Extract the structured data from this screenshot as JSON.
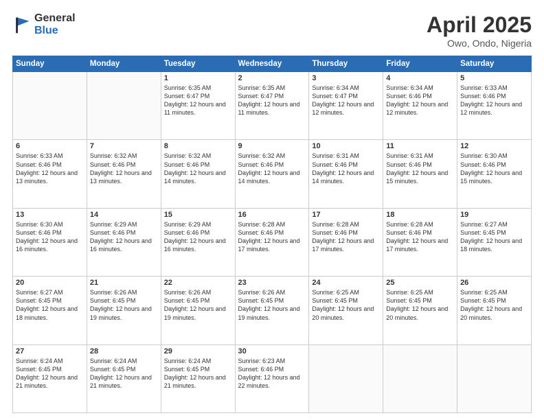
{
  "logo": {
    "general": "General",
    "blue": "Blue"
  },
  "title": {
    "month": "April 2025",
    "location": "Owo, Ondo, Nigeria"
  },
  "weekdays": [
    "Sunday",
    "Monday",
    "Tuesday",
    "Wednesday",
    "Thursday",
    "Friday",
    "Saturday"
  ],
  "weeks": [
    [
      {
        "day": "",
        "info": ""
      },
      {
        "day": "",
        "info": ""
      },
      {
        "day": "1",
        "info": "Sunrise: 6:35 AM\nSunset: 6:47 PM\nDaylight: 12 hours and 11 minutes."
      },
      {
        "day": "2",
        "info": "Sunrise: 6:35 AM\nSunset: 6:47 PM\nDaylight: 12 hours and 11 minutes."
      },
      {
        "day": "3",
        "info": "Sunrise: 6:34 AM\nSunset: 6:47 PM\nDaylight: 12 hours and 12 minutes."
      },
      {
        "day": "4",
        "info": "Sunrise: 6:34 AM\nSunset: 6:46 PM\nDaylight: 12 hours and 12 minutes."
      },
      {
        "day": "5",
        "info": "Sunrise: 6:33 AM\nSunset: 6:46 PM\nDaylight: 12 hours and 12 minutes."
      }
    ],
    [
      {
        "day": "6",
        "info": "Sunrise: 6:33 AM\nSunset: 6:46 PM\nDaylight: 12 hours and 13 minutes."
      },
      {
        "day": "7",
        "info": "Sunrise: 6:32 AM\nSunset: 6:46 PM\nDaylight: 12 hours and 13 minutes."
      },
      {
        "day": "8",
        "info": "Sunrise: 6:32 AM\nSunset: 6:46 PM\nDaylight: 12 hours and 14 minutes."
      },
      {
        "day": "9",
        "info": "Sunrise: 6:32 AM\nSunset: 6:46 PM\nDaylight: 12 hours and 14 minutes."
      },
      {
        "day": "10",
        "info": "Sunrise: 6:31 AM\nSunset: 6:46 PM\nDaylight: 12 hours and 14 minutes."
      },
      {
        "day": "11",
        "info": "Sunrise: 6:31 AM\nSunset: 6:46 PM\nDaylight: 12 hours and 15 minutes."
      },
      {
        "day": "12",
        "info": "Sunrise: 6:30 AM\nSunset: 6:46 PM\nDaylight: 12 hours and 15 minutes."
      }
    ],
    [
      {
        "day": "13",
        "info": "Sunrise: 6:30 AM\nSunset: 6:46 PM\nDaylight: 12 hours and 16 minutes."
      },
      {
        "day": "14",
        "info": "Sunrise: 6:29 AM\nSunset: 6:46 PM\nDaylight: 12 hours and 16 minutes."
      },
      {
        "day": "15",
        "info": "Sunrise: 6:29 AM\nSunset: 6:46 PM\nDaylight: 12 hours and 16 minutes."
      },
      {
        "day": "16",
        "info": "Sunrise: 6:28 AM\nSunset: 6:46 PM\nDaylight: 12 hours and 17 minutes."
      },
      {
        "day": "17",
        "info": "Sunrise: 6:28 AM\nSunset: 6:46 PM\nDaylight: 12 hours and 17 minutes."
      },
      {
        "day": "18",
        "info": "Sunrise: 6:28 AM\nSunset: 6:46 PM\nDaylight: 12 hours and 17 minutes."
      },
      {
        "day": "19",
        "info": "Sunrise: 6:27 AM\nSunset: 6:45 PM\nDaylight: 12 hours and 18 minutes."
      }
    ],
    [
      {
        "day": "20",
        "info": "Sunrise: 6:27 AM\nSunset: 6:45 PM\nDaylight: 12 hours and 18 minutes."
      },
      {
        "day": "21",
        "info": "Sunrise: 6:26 AM\nSunset: 6:45 PM\nDaylight: 12 hours and 19 minutes."
      },
      {
        "day": "22",
        "info": "Sunrise: 6:26 AM\nSunset: 6:45 PM\nDaylight: 12 hours and 19 minutes."
      },
      {
        "day": "23",
        "info": "Sunrise: 6:26 AM\nSunset: 6:45 PM\nDaylight: 12 hours and 19 minutes."
      },
      {
        "day": "24",
        "info": "Sunrise: 6:25 AM\nSunset: 6:45 PM\nDaylight: 12 hours and 20 minutes."
      },
      {
        "day": "25",
        "info": "Sunrise: 6:25 AM\nSunset: 6:45 PM\nDaylight: 12 hours and 20 minutes."
      },
      {
        "day": "26",
        "info": "Sunrise: 6:25 AM\nSunset: 6:45 PM\nDaylight: 12 hours and 20 minutes."
      }
    ],
    [
      {
        "day": "27",
        "info": "Sunrise: 6:24 AM\nSunset: 6:45 PM\nDaylight: 12 hours and 21 minutes."
      },
      {
        "day": "28",
        "info": "Sunrise: 6:24 AM\nSunset: 6:45 PM\nDaylight: 12 hours and 21 minutes."
      },
      {
        "day": "29",
        "info": "Sunrise: 6:24 AM\nSunset: 6:45 PM\nDaylight: 12 hours and 21 minutes."
      },
      {
        "day": "30",
        "info": "Sunrise: 6:23 AM\nSunset: 6:46 PM\nDaylight: 12 hours and 22 minutes."
      },
      {
        "day": "",
        "info": ""
      },
      {
        "day": "",
        "info": ""
      },
      {
        "day": "",
        "info": ""
      }
    ]
  ]
}
